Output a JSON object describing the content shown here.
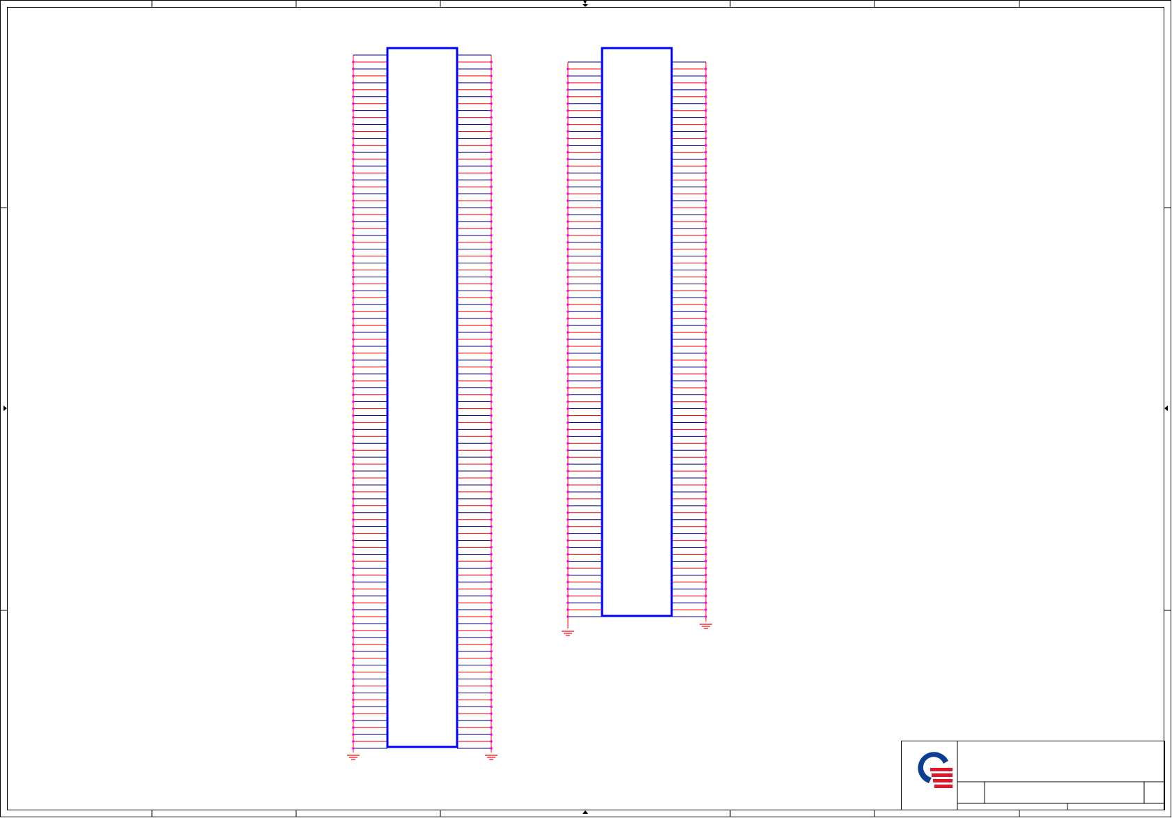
{
  "colors": {
    "frame": "#000000",
    "component_body": "#0000ff",
    "wire": "#ff0000",
    "net_line": "#000080",
    "pin_dot": "#ff00ff",
    "ground": "#ff0000",
    "logo_blue": "#0b3d91",
    "logo_red": "#e0162b",
    "background": "#ffffff"
  },
  "connectors": [
    {
      "name": "left-connector",
      "pins_per_side": 100,
      "left_ground": true,
      "right_ground": true
    },
    {
      "name": "right-connector",
      "pins_per_side": 80,
      "left_ground": true,
      "right_ground": true
    }
  ],
  "title_block": {
    "logo_icon": "company-logo-icon"
  }
}
